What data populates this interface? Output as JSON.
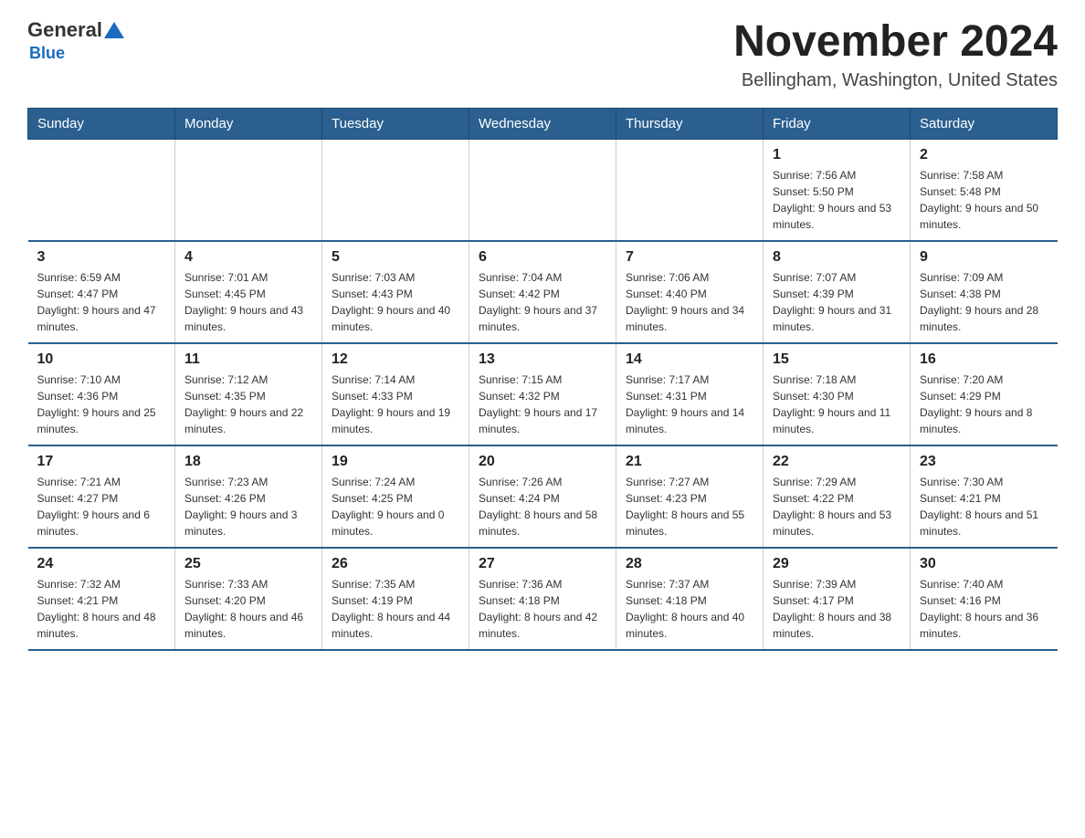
{
  "logo": {
    "general": "General",
    "blue_text": "Blue",
    "subtitle": "Blue"
  },
  "title": "November 2024",
  "location": "Bellingham, Washington, United States",
  "days_of_week": [
    "Sunday",
    "Monday",
    "Tuesday",
    "Wednesday",
    "Thursday",
    "Friday",
    "Saturday"
  ],
  "weeks": [
    [
      {
        "day": "",
        "info": ""
      },
      {
        "day": "",
        "info": ""
      },
      {
        "day": "",
        "info": ""
      },
      {
        "day": "",
        "info": ""
      },
      {
        "day": "",
        "info": ""
      },
      {
        "day": "1",
        "info": "Sunrise: 7:56 AM\nSunset: 5:50 PM\nDaylight: 9 hours and 53 minutes."
      },
      {
        "day": "2",
        "info": "Sunrise: 7:58 AM\nSunset: 5:48 PM\nDaylight: 9 hours and 50 minutes."
      }
    ],
    [
      {
        "day": "3",
        "info": "Sunrise: 6:59 AM\nSunset: 4:47 PM\nDaylight: 9 hours and 47 minutes."
      },
      {
        "day": "4",
        "info": "Sunrise: 7:01 AM\nSunset: 4:45 PM\nDaylight: 9 hours and 43 minutes."
      },
      {
        "day": "5",
        "info": "Sunrise: 7:03 AM\nSunset: 4:43 PM\nDaylight: 9 hours and 40 minutes."
      },
      {
        "day": "6",
        "info": "Sunrise: 7:04 AM\nSunset: 4:42 PM\nDaylight: 9 hours and 37 minutes."
      },
      {
        "day": "7",
        "info": "Sunrise: 7:06 AM\nSunset: 4:40 PM\nDaylight: 9 hours and 34 minutes."
      },
      {
        "day": "8",
        "info": "Sunrise: 7:07 AM\nSunset: 4:39 PM\nDaylight: 9 hours and 31 minutes."
      },
      {
        "day": "9",
        "info": "Sunrise: 7:09 AM\nSunset: 4:38 PM\nDaylight: 9 hours and 28 minutes."
      }
    ],
    [
      {
        "day": "10",
        "info": "Sunrise: 7:10 AM\nSunset: 4:36 PM\nDaylight: 9 hours and 25 minutes."
      },
      {
        "day": "11",
        "info": "Sunrise: 7:12 AM\nSunset: 4:35 PM\nDaylight: 9 hours and 22 minutes."
      },
      {
        "day": "12",
        "info": "Sunrise: 7:14 AM\nSunset: 4:33 PM\nDaylight: 9 hours and 19 minutes."
      },
      {
        "day": "13",
        "info": "Sunrise: 7:15 AM\nSunset: 4:32 PM\nDaylight: 9 hours and 17 minutes."
      },
      {
        "day": "14",
        "info": "Sunrise: 7:17 AM\nSunset: 4:31 PM\nDaylight: 9 hours and 14 minutes."
      },
      {
        "day": "15",
        "info": "Sunrise: 7:18 AM\nSunset: 4:30 PM\nDaylight: 9 hours and 11 minutes."
      },
      {
        "day": "16",
        "info": "Sunrise: 7:20 AM\nSunset: 4:29 PM\nDaylight: 9 hours and 8 minutes."
      }
    ],
    [
      {
        "day": "17",
        "info": "Sunrise: 7:21 AM\nSunset: 4:27 PM\nDaylight: 9 hours and 6 minutes."
      },
      {
        "day": "18",
        "info": "Sunrise: 7:23 AM\nSunset: 4:26 PM\nDaylight: 9 hours and 3 minutes."
      },
      {
        "day": "19",
        "info": "Sunrise: 7:24 AM\nSunset: 4:25 PM\nDaylight: 9 hours and 0 minutes."
      },
      {
        "day": "20",
        "info": "Sunrise: 7:26 AM\nSunset: 4:24 PM\nDaylight: 8 hours and 58 minutes."
      },
      {
        "day": "21",
        "info": "Sunrise: 7:27 AM\nSunset: 4:23 PM\nDaylight: 8 hours and 55 minutes."
      },
      {
        "day": "22",
        "info": "Sunrise: 7:29 AM\nSunset: 4:22 PM\nDaylight: 8 hours and 53 minutes."
      },
      {
        "day": "23",
        "info": "Sunrise: 7:30 AM\nSunset: 4:21 PM\nDaylight: 8 hours and 51 minutes."
      }
    ],
    [
      {
        "day": "24",
        "info": "Sunrise: 7:32 AM\nSunset: 4:21 PM\nDaylight: 8 hours and 48 minutes."
      },
      {
        "day": "25",
        "info": "Sunrise: 7:33 AM\nSunset: 4:20 PM\nDaylight: 8 hours and 46 minutes."
      },
      {
        "day": "26",
        "info": "Sunrise: 7:35 AM\nSunset: 4:19 PM\nDaylight: 8 hours and 44 minutes."
      },
      {
        "day": "27",
        "info": "Sunrise: 7:36 AM\nSunset: 4:18 PM\nDaylight: 8 hours and 42 minutes."
      },
      {
        "day": "28",
        "info": "Sunrise: 7:37 AM\nSunset: 4:18 PM\nDaylight: 8 hours and 40 minutes."
      },
      {
        "day": "29",
        "info": "Sunrise: 7:39 AM\nSunset: 4:17 PM\nDaylight: 8 hours and 38 minutes."
      },
      {
        "day": "30",
        "info": "Sunrise: 7:40 AM\nSunset: 4:16 PM\nDaylight: 8 hours and 36 minutes."
      }
    ]
  ]
}
